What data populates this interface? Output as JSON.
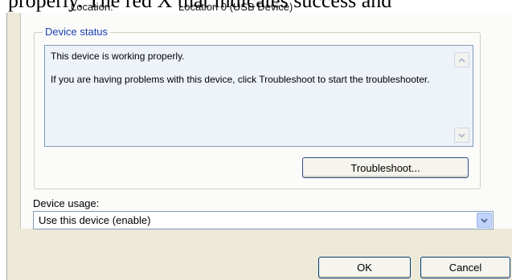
{
  "background_fragment": "properly. The red X that indicates success and",
  "location": {
    "label": "Location:",
    "value": "Location 0 (USB Device)"
  },
  "device_status": {
    "title": "Device status",
    "lines": [
      "This device is working properly.",
      "If you are having problems with this device, click Troubleshoot to start the troubleshooter."
    ],
    "troubleshoot_label": "Troubleshoot..."
  },
  "device_usage": {
    "label": "Device usage:",
    "selected": "Use this device (enable)"
  },
  "footer": {
    "ok_label": "OK",
    "cancel_label": "Cancel"
  },
  "colors": {
    "dialog_bg": "#ece9d8",
    "group_title": "#1a3fb5",
    "status_box_bg": "#eef3fa",
    "button_border": "#003c74"
  },
  "icons": {
    "scroll_up": "chevron-up-icon",
    "scroll_down": "chevron-down-icon",
    "dropdown": "chevron-down-icon"
  }
}
